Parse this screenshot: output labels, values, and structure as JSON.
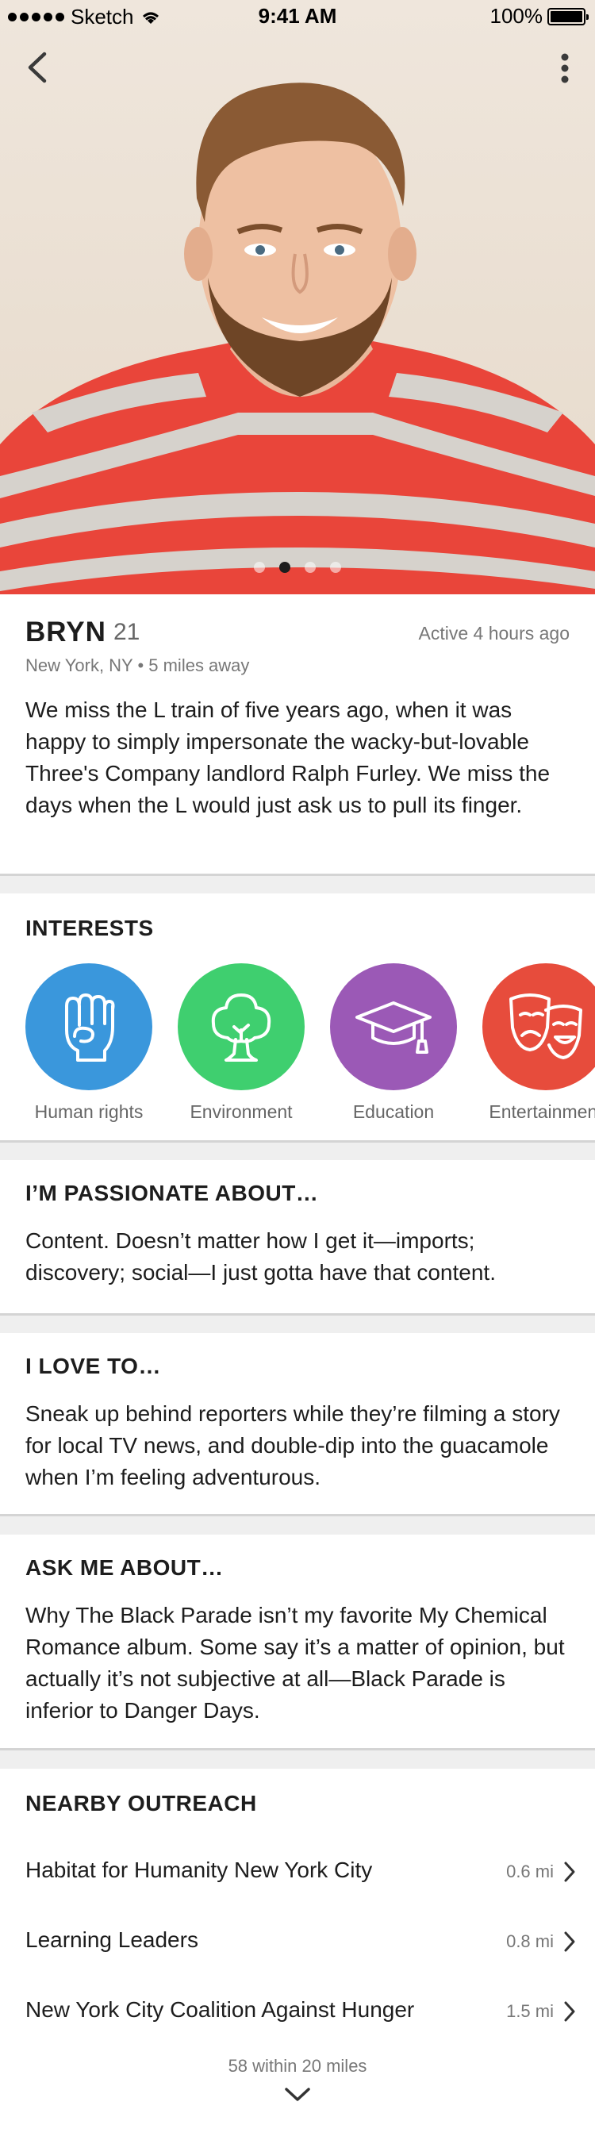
{
  "status_bar": {
    "carrier": "Sketch",
    "time": "9:41 AM",
    "battery": "100%"
  },
  "hero": {
    "photo_count": 4,
    "active_photo_index": 1
  },
  "profile": {
    "name": "BRYN",
    "age": "21",
    "active": "Active 4 hours ago",
    "location": "New York, NY • 5 miles away",
    "bio": "We miss the L train of five years ago, when it was happy to simply impersonate the wacky-but-lovable Three's Company landlord Ralph Furley. We miss the days when the L would just ask us to pull its finger."
  },
  "interests": {
    "title": "INTERESTS",
    "items": [
      {
        "label": "Human rights",
        "icon": "raised-fist-icon",
        "color": "#3a97dc"
      },
      {
        "label": "Environment",
        "icon": "tree-icon",
        "color": "#3fcf6f"
      },
      {
        "label": "Education",
        "icon": "graduation-cap-icon",
        "color": "#9b59b6"
      },
      {
        "label": "Entertainment",
        "icon": "theater-masks-icon",
        "color": "#e74c3c"
      }
    ]
  },
  "passionate": {
    "title": "I’M PASSIONATE ABOUT…",
    "text": "Content. Doesn’t matter how I get it—imports; discovery; social—I just gotta have that content."
  },
  "love_to": {
    "title": "I LOVE TO…",
    "text": "Sneak up behind reporters while they’re filming a story for local TV news, and double-dip into the guacamole when I’m feeling adventurous."
  },
  "ask_me": {
    "title": "ASK ME ABOUT…",
    "text": "Why The Black Parade isn’t my favorite My Chemical Romance album. Some say it’s a matter of opinion, but actually it’s not subjective at all—Black Parade is inferior to Danger Days."
  },
  "outreach": {
    "title": "NEARBY OUTREACH",
    "items": [
      {
        "name": "Habitat for Humanity New York City",
        "distance": "0.6 mi"
      },
      {
        "name": "Learning Leaders",
        "distance": "0.8 mi"
      },
      {
        "name": "New York City Coalition Against Hunger",
        "distance": "1.5 mi"
      }
    ],
    "summary": "58 within 20 miles"
  }
}
